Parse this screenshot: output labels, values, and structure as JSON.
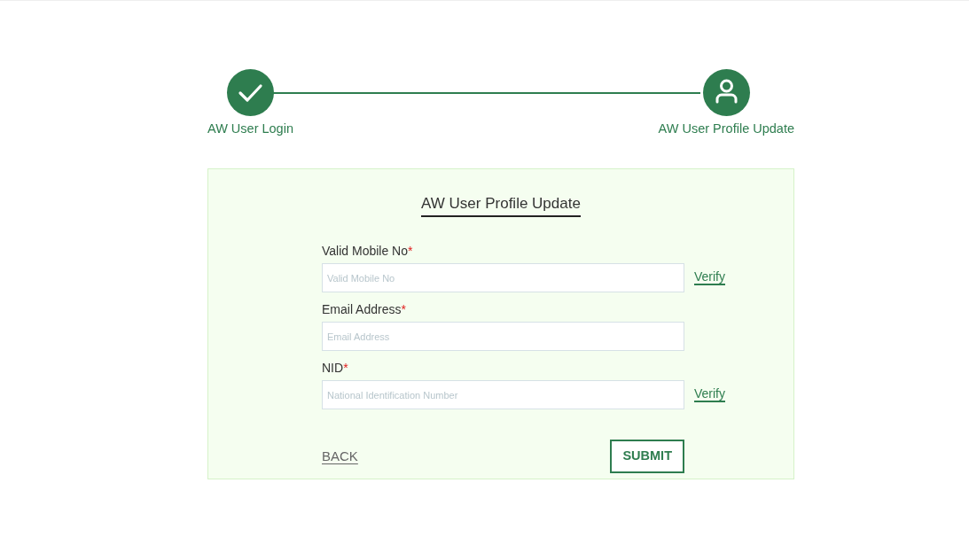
{
  "steps": [
    {
      "kind": "check",
      "label": "AW User Login"
    },
    {
      "kind": "user",
      "label": "AW User Profile Update"
    }
  ],
  "form": {
    "title": "AW User Profile Update",
    "fields": [
      {
        "label": "Valid Mobile No",
        "required_mark": "*",
        "placeholder": "Valid Mobile No",
        "action": "Verify"
      },
      {
        "label": "Email Address",
        "required_mark": "*",
        "placeholder": "Email Address"
      },
      {
        "label": "NID",
        "required_mark": "*",
        "placeholder": "National Identification Number",
        "action": "Verify"
      }
    ],
    "back": "BACK",
    "submit": "SUBMIT"
  }
}
